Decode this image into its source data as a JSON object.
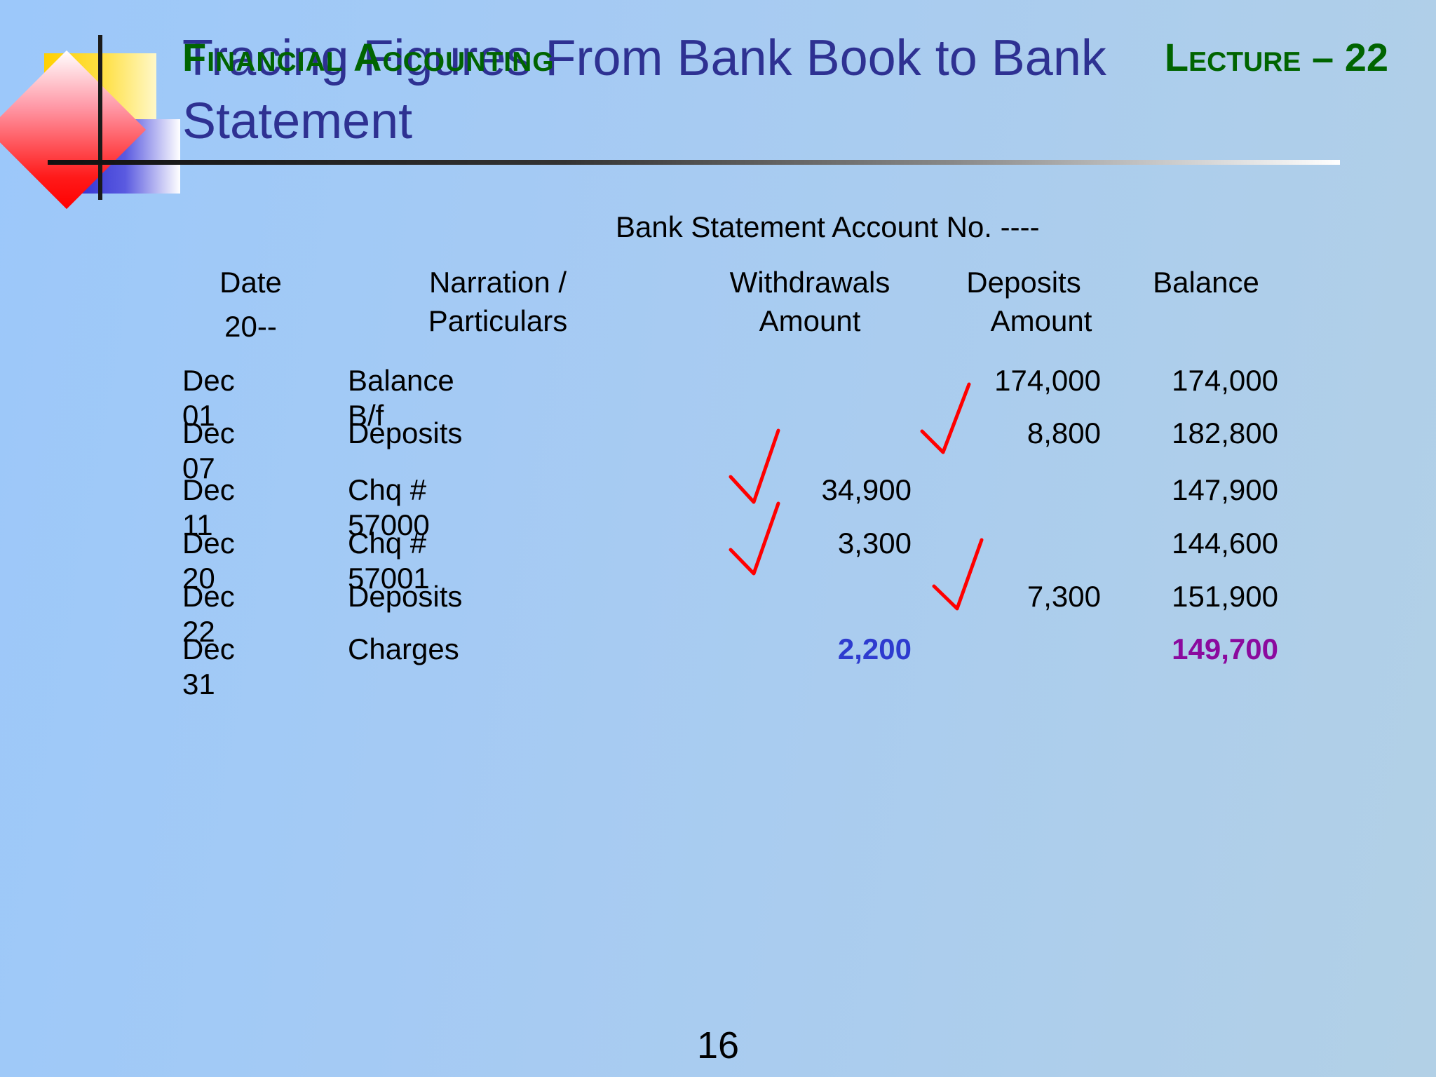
{
  "slide": {
    "title": "Tracing Figures From Bank Book to Bank Statement",
    "course": "Financial Accounting",
    "lecture": "Lecture – 22",
    "page_number": "16"
  },
  "table": {
    "caption": "Bank Statement Account No. ----",
    "headers": {
      "date": "Date",
      "date_year": "20--",
      "narration": "Narration /",
      "narration2": "Particulars",
      "withdrawals": "Withdrawals",
      "withdrawals2": "Amount",
      "deposits": "Deposits",
      "deposits2": "Amount",
      "balance": "Balance"
    },
    "rows": [
      {
        "date": "Dec 01",
        "narration": "Balance B/f",
        "withdrawal": "",
        "deposit": "174,000",
        "balance": "174,000",
        "withdrawal_ticked": false,
        "deposit_ticked": true
      },
      {
        "date": "Dec 07",
        "narration": "Deposits",
        "withdrawal": "",
        "deposit": "8,800",
        "balance": "182,800",
        "withdrawal_ticked": false,
        "deposit_ticked": false
      },
      {
        "date": "Dec 11",
        "narration": "Chq # 57000",
        "withdrawal": "34,900",
        "deposit": "",
        "balance": "147,900",
        "withdrawal_ticked": true,
        "deposit_ticked": false
      },
      {
        "date": "Dec 20",
        "narration": "Chq # 57001",
        "withdrawal": "3,300",
        "deposit": "",
        "balance": "144,600",
        "withdrawal_ticked": true,
        "deposit_ticked": false
      },
      {
        "date": "Dec 22",
        "narration": "Deposits",
        "withdrawal": "",
        "deposit": "7,300",
        "balance": "151,900",
        "withdrawal_ticked": false,
        "deposit_ticked": true
      },
      {
        "date": "Dec 31",
        "narration": "Charges",
        "withdrawal": "2,200",
        "deposit": "",
        "balance": "149,700",
        "withdrawal_ticked": false,
        "deposit_ticked": false
      }
    ]
  },
  "colors": {
    "title": "#2e3192",
    "course": "#006400",
    "highlight_withdrawal": "#2e3bcf",
    "highlight_balance": "#8b0a9e",
    "tick": "#ff0000"
  }
}
